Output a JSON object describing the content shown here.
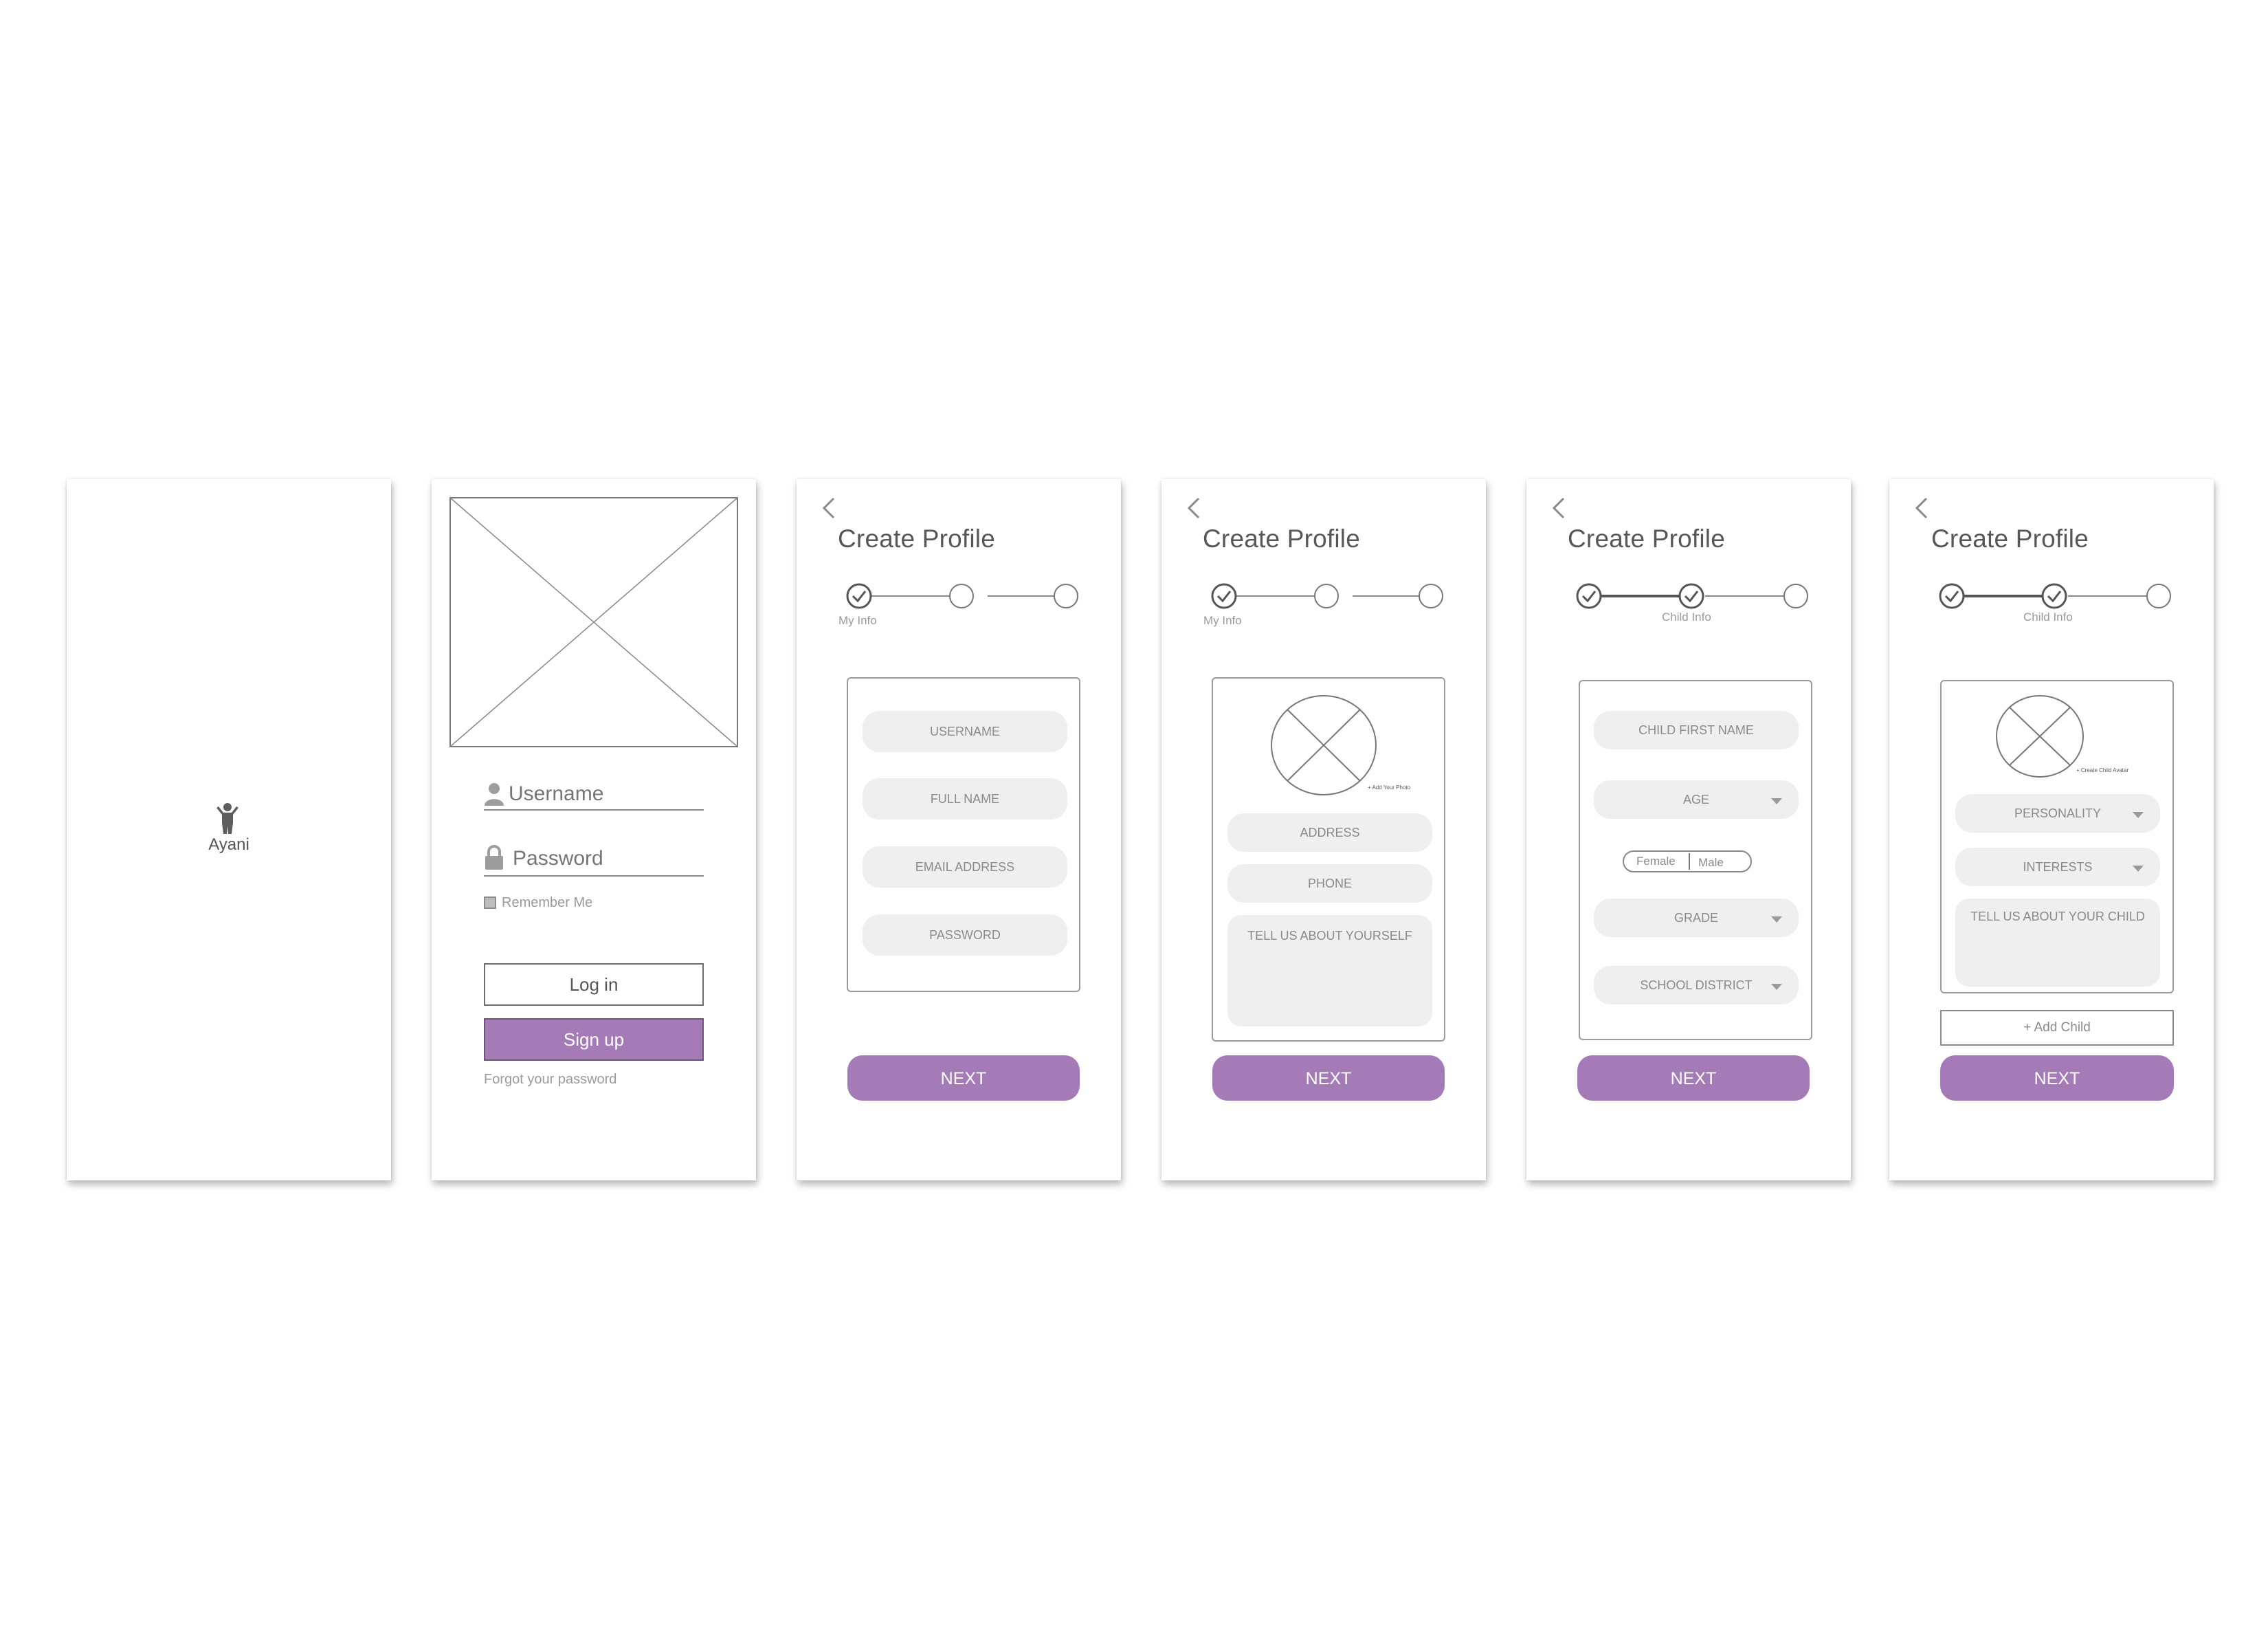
{
  "app": {
    "name": "Ayani"
  },
  "login": {
    "username_placeholder": "Username",
    "password_placeholder": "Password",
    "remember_label": "Remember Me",
    "login_label": "Log in",
    "signup_label": "Sign up",
    "forgot_label": "Forgot your password"
  },
  "profile": {
    "title": "Create Profile",
    "next_label": "NEXT",
    "steps": {
      "my_info": "My Info",
      "child_info": "Child Info"
    },
    "screen3": {
      "fields": [
        "USERNAME",
        "FULL NAME",
        "EMAIL ADDRESS",
        "PASSWORD"
      ]
    },
    "screen4": {
      "add_photo": "+ Add Your Photo",
      "fields": [
        "ADDRESS",
        "PHONE"
      ],
      "about": "TELL US ABOUT YOURSELF"
    },
    "screen5": {
      "child_first_name": "CHILD FIRST NAME",
      "age": "AGE",
      "female": "Female",
      "male": "Male",
      "grade": "GRADE",
      "school_district": "SCHOOL DISTRICT"
    },
    "screen6": {
      "create_avatar": "+ Create Child Avatar",
      "personality": "PERSONALITY",
      "interests": "INTERESTS",
      "about_child": "TELL US ABOUT YOUR CHILD",
      "add_child": "+ Add Child"
    }
  },
  "colors": {
    "accent": "#a47bb6",
    "field_bg": "#efefef",
    "border": "#9b9b9b",
    "text": "#575757"
  }
}
